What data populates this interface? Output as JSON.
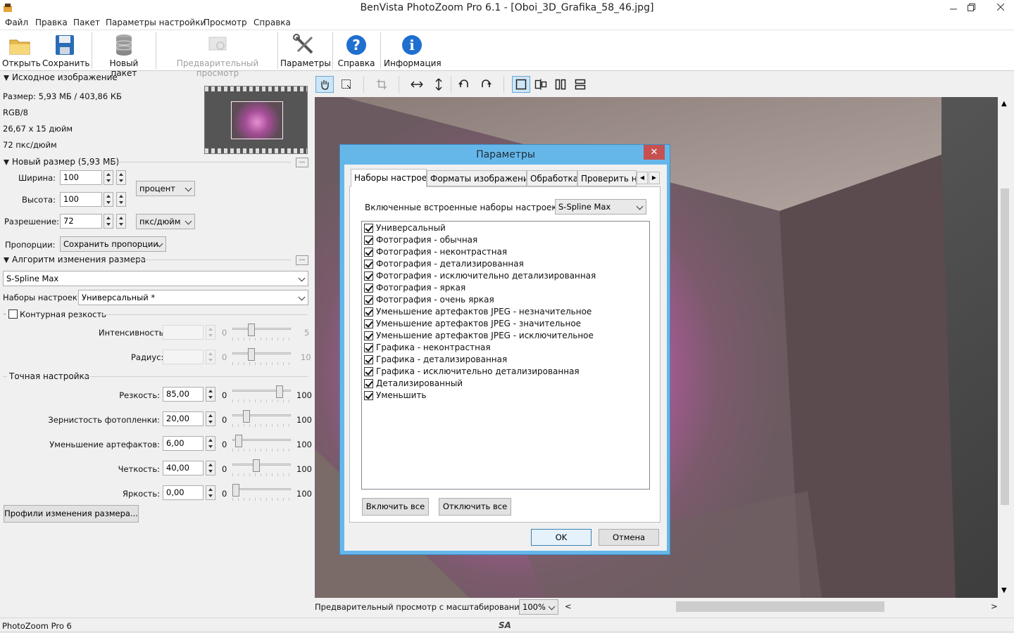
{
  "window": {
    "title": "BenVista PhotoZoom Pro 6.1 - [Oboi_3D_Grafika_58_46.jpg]"
  },
  "menu": [
    "Файл",
    "Правка",
    "Пакет",
    "Параметры настройки",
    "Просмотр",
    "Справка"
  ],
  "toolbar": {
    "open": "Открыть",
    "save": "Сохранить",
    "batch": "Новый пакет",
    "preview": "Предварительный просмотр",
    "settings": "Параметры",
    "help": "Справка",
    "info": "Информация"
  },
  "source": {
    "header": "Исходное изображение",
    "size": "Размер: 5,93 МБ / 403,86 КБ",
    "mode": "RGB/8",
    "dims": "26,67 x 15 дюйм",
    "res": "72 пкс/дюйм"
  },
  "newsize": {
    "header": "Новый размер (5,93 МБ)",
    "width_label": "Ширина:",
    "width": "100",
    "height_label": "Высота:",
    "height": "100",
    "unit": "процент",
    "res_label": "Разрешение:",
    "res": "72",
    "res_unit": "пкс/дюйм",
    "prop_label": "Пропорции:",
    "prop": "Сохранить пропорции",
    "more": "..."
  },
  "algo": {
    "header": "Алгоритм изменения размера",
    "method": "S-Spline Max",
    "preset_label": "Наборы настроек:",
    "preset": "Универсальный *"
  },
  "contour": {
    "label": "Контурная резкость",
    "intensity_label": "Интенсивность:",
    "intensity_min": "0",
    "intensity_max": "5",
    "intensity_level": 0.3,
    "radius_label": "Радиус:",
    "radius_min": "0",
    "radius_max": "10",
    "radius_level": 0.3
  },
  "fine": {
    "header": "Точная настройка",
    "rows": [
      {
        "label": "Резкость:",
        "value": "85,00",
        "min": "0",
        "max": "100",
        "level": 0.85
      },
      {
        "label": "Зернистость фотопленки:",
        "value": "20,00",
        "min": "0",
        "max": "100",
        "level": 0.2
      },
      {
        "label": "Уменьшение артефактов:",
        "value": "6,00",
        "min": "0",
        "max": "100",
        "level": 0.06
      },
      {
        "label": "Четкость:",
        "value": "40,00",
        "min": "0",
        "max": "100",
        "level": 0.4
      },
      {
        "label": "Яркость:",
        "value": "0,00",
        "min": "0",
        "max": "100",
        "level": 0.0
      }
    ],
    "profiles_btn": "Профили изменения размера..."
  },
  "preview": {
    "label": "Предварительный просмотр с масштабированием:",
    "zoom": "100%",
    "scroll_left": "<",
    "scroll_right": ">"
  },
  "status": {
    "app": "PhotoZoom Pro 6",
    "logo": "SA"
  },
  "dialog": {
    "title": "Параметры",
    "close": "✕",
    "tabs": [
      "Наборы настроек",
      "Форматы изображений",
      "Обработка",
      "Проверить на"
    ],
    "presets_for_label": "Включенные встроенные наборы настроек для:",
    "presets_for_value": "S-Spline Max",
    "items": [
      "Универсальный",
      "Фотография - обычная",
      "Фотография - неконтрастная",
      "Фотография - детализированная",
      "Фотография - исключительно детализированная",
      "Фотография - яркая",
      "Фотография - очень яркая",
      "Уменьшение артефактов JPEG - незначительное",
      "Уменьшение артефактов JPEG - значительное",
      "Уменьшение артефактов JPEG - исключительное",
      "Графика - неконтрастная",
      "Графика - детализированная",
      "Графика - исключительно детализированная",
      "Детализированный",
      "Уменьшить"
    ],
    "enable_all": "Включить все",
    "disable_all": "Отключить все",
    "ok": "OK",
    "cancel": "Отмена"
  },
  "colors": {
    "dialog_frame": "#66b7e9",
    "close_red": "#c75050",
    "active_tool": "#cde6f7"
  }
}
